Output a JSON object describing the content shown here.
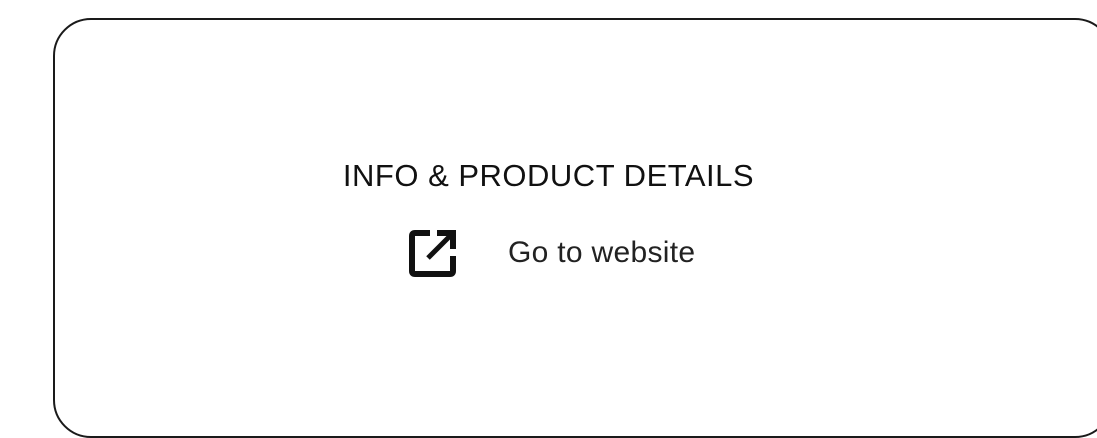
{
  "card": {
    "title": "INFO & PRODUCT DETAILS",
    "link": {
      "label": "Go to website",
      "icon": "external-link-icon"
    }
  },
  "colors": {
    "text": "#111111",
    "border": "#1a1a1a",
    "background": "#ffffff"
  }
}
